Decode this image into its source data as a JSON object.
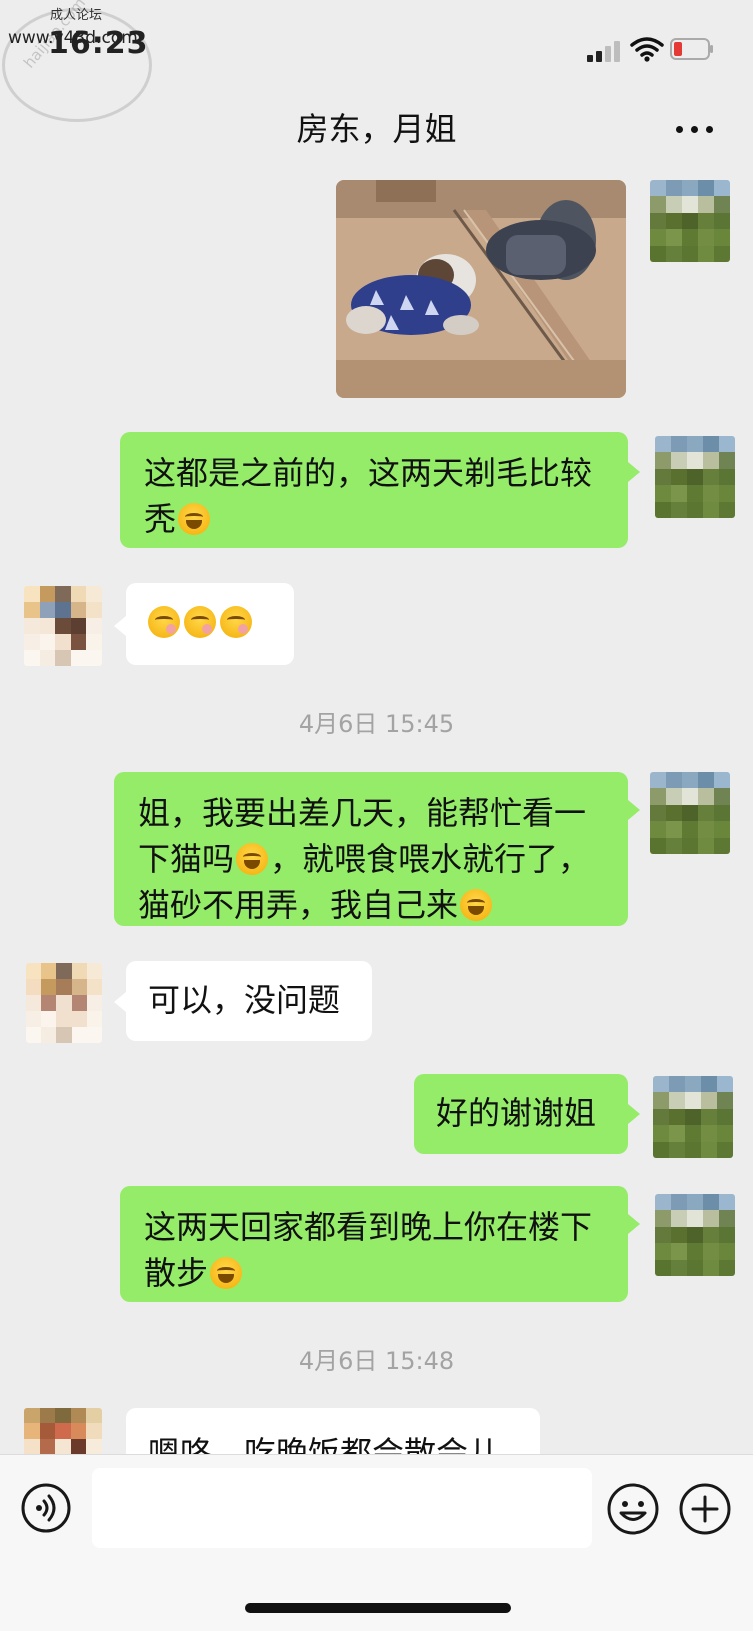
{
  "status_bar": {
    "time": "16:23",
    "watermark_top": "成人论坛",
    "watermark_url": "www.v43d.com",
    "watermark_diag": "haijiao.com"
  },
  "header": {
    "title": "房东，月姐"
  },
  "messages": [
    {
      "id": "m1",
      "sender": "me",
      "type": "image"
    },
    {
      "id": "m2",
      "sender": "me",
      "text": "这都是之前的，这两天剃毛比较\n秃",
      "emoji_after": [
        "laugh-cry"
      ]
    },
    {
      "id": "m3",
      "sender": "other",
      "text": "",
      "emoji_after": [
        "think",
        "think",
        "think"
      ]
    },
    {
      "id": "ts1",
      "type": "timestamp",
      "text": "4月6日 15:45"
    },
    {
      "id": "m4",
      "sender": "me",
      "parts": [
        "姐，我要出差几天，能帮忙看一\n下猫吗",
        "，就喂食喂水就行了，\n猫砂不用弄，我自己来"
      ]
    },
    {
      "id": "m5",
      "sender": "other",
      "text": "可以，没问题"
    },
    {
      "id": "m6",
      "sender": "me",
      "text": "好的谢谢姐"
    },
    {
      "id": "m7",
      "sender": "me",
      "text": "这两天回家都看到晚上你在楼下\n散步",
      "emoji_after": [
        "laugh-cry"
      ]
    },
    {
      "id": "ts2",
      "type": "timestamp",
      "text": "4月6日 15:48"
    },
    {
      "id": "m8",
      "sender": "other",
      "text": "嗯咯，吃晚饭都会散会儿"
    }
  ],
  "input_bar": {
    "placeholder": ""
  },
  "colors": {
    "bubble_me": "#95ec69",
    "bubble_other": "#ffffff",
    "background": "#ededed"
  },
  "icons": [
    "voice-icon",
    "emoji-icon",
    "plus-icon",
    "more-icon",
    "signal-icon",
    "wifi-icon",
    "battery-icon"
  ]
}
